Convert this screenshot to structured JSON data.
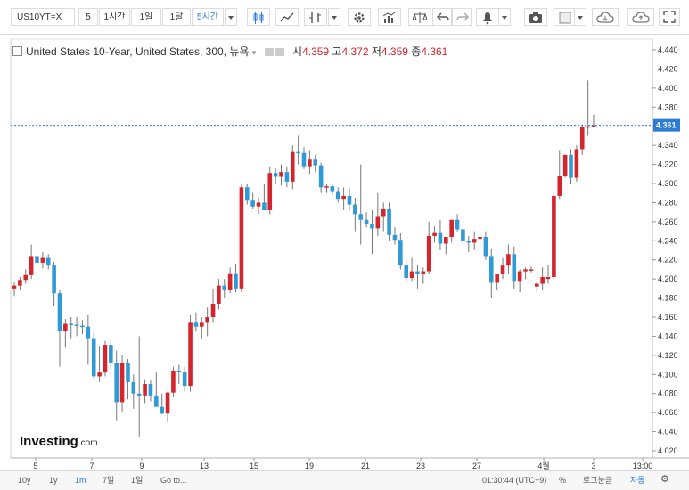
{
  "toolbar": {
    "symbol": "US10YT=X",
    "intervals": [
      "5",
      "1시간",
      "1일",
      "1달",
      "5시간"
    ],
    "active_interval": "5시간"
  },
  "legend": {
    "title": "United States 10-Year, United States, 300, 뉴욕",
    "open_label": "시",
    "open": "4.359",
    "high_label": "고",
    "high": "4.372",
    "low_label": "저",
    "low": "4.359",
    "close_label": "종",
    "close": "4.361"
  },
  "last_price": "4.361",
  "logo": {
    "name": "Investing",
    "suffix": ".com"
  },
  "bottombar": {
    "ranges": [
      "10y",
      "1y",
      "1m",
      "7일",
      "1일",
      "Go to..."
    ],
    "active_range": "1m",
    "time": "01:30:44 (UTC+9)",
    "percent": "%",
    "log": "로그눈금",
    "auto": "자동"
  },
  "colors": {
    "up": "#d4252c",
    "down": "#2f9ad6",
    "last_line": "#2e7bd6"
  },
  "chart_data": {
    "type": "candlestick",
    "title": "United States 10-Year, United States, 300, 뉴욕",
    "ylim": [
      4.02,
      4.44
    ],
    "y_ticks": [
      "4.020",
      "4.040",
      "4.060",
      "4.080",
      "4.100",
      "4.120",
      "4.140",
      "4.160",
      "4.180",
      "4.200",
      "4.220",
      "4.240",
      "4.260",
      "4.280",
      "4.300",
      "4.320",
      "4.340",
      "4.360",
      "4.380",
      "4.400",
      "4.420",
      "4.440"
    ],
    "x_ticks": [
      "5",
      "7",
      "9",
      "13",
      "15",
      "19",
      "21",
      "23",
      "27",
      "4월",
      "3",
      "13:00"
    ],
    "candles": [
      [
        4.19,
        4.196,
        4.182,
        4.193
      ],
      [
        4.193,
        4.202,
        4.188,
        4.199
      ],
      [
        4.199,
        4.21,
        4.195,
        4.204
      ],
      [
        4.204,
        4.236,
        4.2,
        4.224
      ],
      [
        4.224,
        4.23,
        4.212,
        4.217
      ],
      [
        4.217,
        4.228,
        4.211,
        4.222
      ],
      [
        4.222,
        4.226,
        4.21,
        4.214
      ],
      [
        4.214,
        4.218,
        4.172,
        4.185
      ],
      [
        4.185,
        4.188,
        4.108,
        4.145
      ],
      [
        4.145,
        4.158,
        4.128,
        4.153
      ],
      [
        4.153,
        4.16,
        4.138,
        4.152
      ],
      [
        4.152,
        4.16,
        4.14,
        4.151
      ],
      [
        4.151,
        4.157,
        4.142,
        4.15
      ],
      [
        4.15,
        4.162,
        4.11,
        4.138
      ],
      [
        4.138,
        4.145,
        4.095,
        4.098
      ],
      [
        4.098,
        4.13,
        4.092,
        4.102
      ],
      [
        4.102,
        4.135,
        4.098,
        4.131
      ],
      [
        4.131,
        4.135,
        4.1,
        4.112
      ],
      [
        4.112,
        4.125,
        4.052,
        4.071
      ],
      [
        4.071,
        4.12,
        4.06,
        4.112
      ],
      [
        4.112,
        4.116,
        4.074,
        4.092
      ],
      [
        4.092,
        4.1,
        4.064,
        4.08
      ],
      [
        4.08,
        4.14,
        4.035,
        4.078
      ],
      [
        4.078,
        4.095,
        4.07,
        4.09
      ],
      [
        4.09,
        4.094,
        4.072,
        4.078
      ],
      [
        4.078,
        4.102,
        4.07,
        4.066
      ],
      [
        4.066,
        4.08,
        4.058,
        4.059
      ],
      [
        4.059,
        4.082,
        4.05,
        4.081
      ],
      [
        4.081,
        4.108,
        4.076,
        4.104
      ],
      [
        4.104,
        4.11,
        4.09,
        4.103
      ],
      [
        4.103,
        4.108,
        4.082,
        4.088
      ],
      [
        4.088,
        4.162,
        4.082,
        4.155
      ],
      [
        4.155,
        4.165,
        4.145,
        4.15
      ],
      [
        4.15,
        4.16,
        4.137,
        4.155
      ],
      [
        4.155,
        4.17,
        4.14,
        4.16
      ],
      [
        4.16,
        4.19,
        4.155,
        4.174
      ],
      [
        4.174,
        4.2,
        4.168,
        4.193
      ],
      [
        4.193,
        4.2,
        4.18,
        4.189
      ],
      [
        4.189,
        4.212,
        4.185,
        4.206
      ],
      [
        4.206,
        4.216,
        4.186,
        4.19
      ],
      [
        4.19,
        4.3,
        4.186,
        4.296
      ],
      [
        4.296,
        4.3,
        4.278,
        4.282
      ],
      [
        4.282,
        4.29,
        4.273,
        4.276
      ],
      [
        4.276,
        4.285,
        4.268,
        4.28
      ],
      [
        4.28,
        4.3,
        4.272,
        4.272
      ],
      [
        4.272,
        4.318,
        4.268,
        4.311
      ],
      [
        4.311,
        4.316,
        4.3,
        4.307
      ],
      [
        4.307,
        4.32,
        4.298,
        4.312
      ],
      [
        4.312,
        4.318,
        4.296,
        4.302
      ],
      [
        4.302,
        4.34,
        4.294,
        4.333
      ],
      [
        4.333,
        4.35,
        4.32,
        4.332
      ],
      [
        4.332,
        4.338,
        4.315,
        4.318
      ],
      [
        4.318,
        4.335,
        4.31,
        4.325
      ],
      [
        4.325,
        4.33,
        4.312,
        4.319
      ],
      [
        4.319,
        4.322,
        4.29,
        4.296
      ],
      [
        4.296,
        4.3,
        4.29,
        4.297
      ],
      [
        4.297,
        4.3,
        4.288,
        4.292
      ],
      [
        4.292,
        4.296,
        4.28,
        4.284
      ],
      [
        4.284,
        4.296,
        4.272,
        4.287
      ],
      [
        4.287,
        4.295,
        4.272,
        4.278
      ],
      [
        4.278,
        4.285,
        4.25,
        4.268
      ],
      [
        4.268,
        4.32,
        4.236,
        4.262
      ],
      [
        4.262,
        4.27,
        4.254,
        4.258
      ],
      [
        4.258,
        4.272,
        4.226,
        4.253
      ],
      [
        4.253,
        4.29,
        4.245,
        4.265
      ],
      [
        4.265,
        4.28,
        4.25,
        4.273
      ],
      [
        4.273,
        4.28,
        4.24,
        4.246
      ],
      [
        4.246,
        4.254,
        4.236,
        4.241
      ],
      [
        4.241,
        4.248,
        4.21,
        4.214
      ],
      [
        4.214,
        4.22,
        4.196,
        4.201
      ],
      [
        4.201,
        4.222,
        4.198,
        4.208
      ],
      [
        4.208,
        4.215,
        4.19,
        4.205
      ],
      [
        4.205,
        4.212,
        4.195,
        4.208
      ],
      [
        4.208,
        4.26,
        4.205,
        4.245
      ],
      [
        4.245,
        4.255,
        4.238,
        4.249
      ],
      [
        4.249,
        4.262,
        4.23,
        4.237
      ],
      [
        4.237,
        4.244,
        4.226,
        4.244
      ],
      [
        4.244,
        4.262,
        4.238,
        4.262
      ],
      [
        4.262,
        4.268,
        4.25,
        4.252
      ],
      [
        4.252,
        4.258,
        4.236,
        4.24
      ],
      [
        4.24,
        4.245,
        4.228,
        4.238
      ],
      [
        4.238,
        4.25,
        4.23,
        4.242
      ],
      [
        4.242,
        4.248,
        4.226,
        4.244
      ],
      [
        4.244,
        4.25,
        4.22,
        4.224
      ],
      [
        4.224,
        4.232,
        4.18,
        4.196
      ],
      [
        4.196,
        4.205,
        4.188,
        4.205
      ],
      [
        4.205,
        4.222,
        4.2,
        4.214
      ],
      [
        4.214,
        4.236,
        4.205,
        4.226
      ],
      [
        4.226,
        4.234,
        4.19,
        4.198
      ],
      [
        4.198,
        4.21,
        4.186,
        4.208
      ],
      [
        4.208,
        4.212,
        4.2,
        4.21
      ],
      [
        4.21,
        4.213,
        4.207,
        4.21
      ],
      [
        4.192,
        4.198,
        4.186,
        4.195
      ],
      [
        4.195,
        4.212,
        4.188,
        4.202
      ],
      [
        4.2,
        4.215,
        4.195,
        4.202
      ],
      [
        4.202,
        4.292,
        4.198,
        4.287
      ],
      [
        4.287,
        4.335,
        4.284,
        4.308
      ],
      [
        4.308,
        4.33,
        4.306,
        4.33
      ],
      [
        4.33,
        4.336,
        4.3,
        4.306
      ],
      [
        4.306,
        4.34,
        4.302,
        4.336
      ],
      [
        4.336,
        4.362,
        4.33,
        4.359
      ],
      [
        4.359,
        4.408,
        4.35,
        4.36
      ],
      [
        4.359,
        4.372,
        4.359,
        4.361
      ]
    ]
  }
}
